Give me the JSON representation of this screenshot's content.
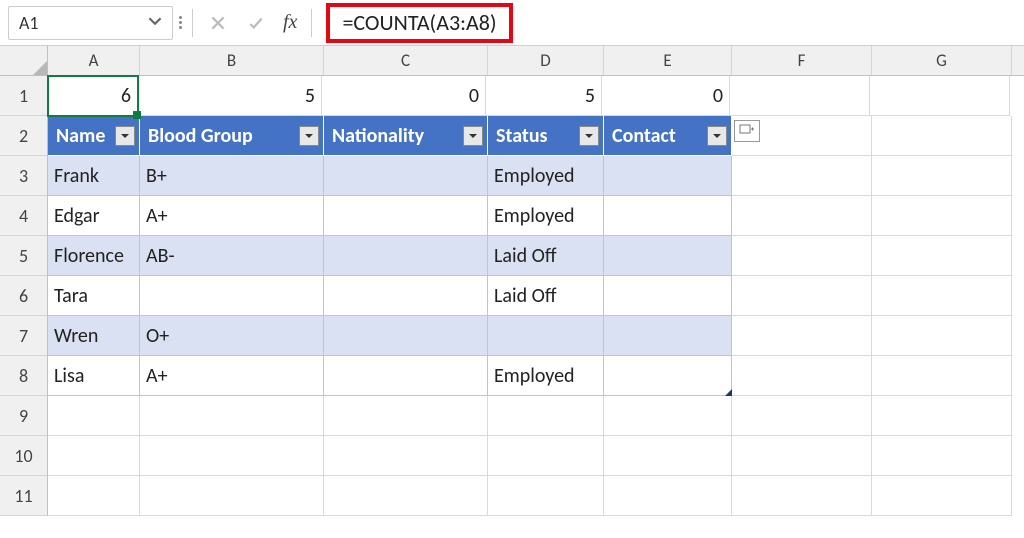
{
  "name_box": "A1",
  "formula": "=COUNTA(A3:A8)",
  "columns": [
    "A",
    "B",
    "C",
    "D",
    "E",
    "F",
    "G"
  ],
  "row_labels": [
    "1",
    "2",
    "3",
    "4",
    "5",
    "6",
    "7",
    "8",
    "9",
    "10",
    "11"
  ],
  "row1": {
    "A": "6",
    "B": "5",
    "C": "0",
    "D": "5",
    "E": "0"
  },
  "headers": {
    "A": "Name",
    "B": "Blood  Group",
    "C": "Nationality",
    "D": "Status",
    "E": "Contact"
  },
  "data": [
    {
      "A": "Frank",
      "B": "B+",
      "C": "",
      "D": "Employed",
      "E": ""
    },
    {
      "A": "Edgar",
      "B": "A+",
      "C": "",
      "D": "Employed",
      "E": ""
    },
    {
      "A": "Florence",
      "B": "AB-",
      "C": "",
      "D": "Laid Off",
      "E": ""
    },
    {
      "A": "Tara",
      "B": "",
      "C": "",
      "D": "Laid Off",
      "E": ""
    },
    {
      "A": "Wren",
      "B": "O+",
      "C": "",
      "D": "",
      "E": ""
    },
    {
      "A": "Lisa",
      "B": "A+",
      "C": "",
      "D": "Employed",
      "E": ""
    }
  ]
}
